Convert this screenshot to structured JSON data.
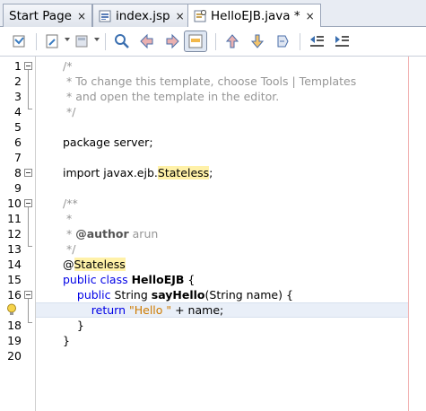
{
  "tabs": [
    {
      "label": "Start Page",
      "close": "×",
      "icon": null
    },
    {
      "label": "index.jsp",
      "close": "×",
      "icon": "jsp-file-icon"
    },
    {
      "label": "HelloEJB.java *",
      "close": "×",
      "icon": "java-class-icon"
    }
  ],
  "toolbar": {
    "icons": [
      "last-edit-icon",
      "back-icon",
      "forward-icon",
      "find-icon",
      "find-previous-icon",
      "find-next-icon",
      "toggle-highlight-icon",
      "previous-bookmark-icon",
      "next-bookmark-icon",
      "toggle-bookmark-icon",
      "shift-left-icon",
      "shift-right-icon"
    ]
  },
  "code": {
    "line_numbers": [
      "1",
      "2",
      "3",
      "4",
      "5",
      "6",
      "7",
      "8",
      "9",
      "10",
      "11",
      "12",
      "13",
      "14",
      "15",
      "16",
      "17",
      "18",
      "19",
      "20"
    ],
    "l1": "/*",
    "l2": " * To change this template, choose Tools | Templates",
    "l3": " * and open the template in the editor.",
    "l4": " */",
    "l6": "package server;",
    "l8_a": "import javax.ejb.",
    "l8_b": "Stateless",
    "l8_c": ";",
    "l10": "/**",
    "l11": " *",
    "l12_a": " * ",
    "l12_b": "@author",
    "l12_c": " arun",
    "l13": " */",
    "l14_a": "@",
    "l14_b": "Stateless",
    "l15_a": "public class ",
    "l15_b": "HelloEJB",
    "l15_c": " {",
    "l16_a": "    public ",
    "l16_b": "String ",
    "l16_c": "sayHello",
    "l16_d": "(String name) {",
    "l17_a": "        return ",
    "l17_b": "\"Hello \"",
    "l17_c": " + name;",
    "l18": "    }",
    "l19": "}"
  }
}
